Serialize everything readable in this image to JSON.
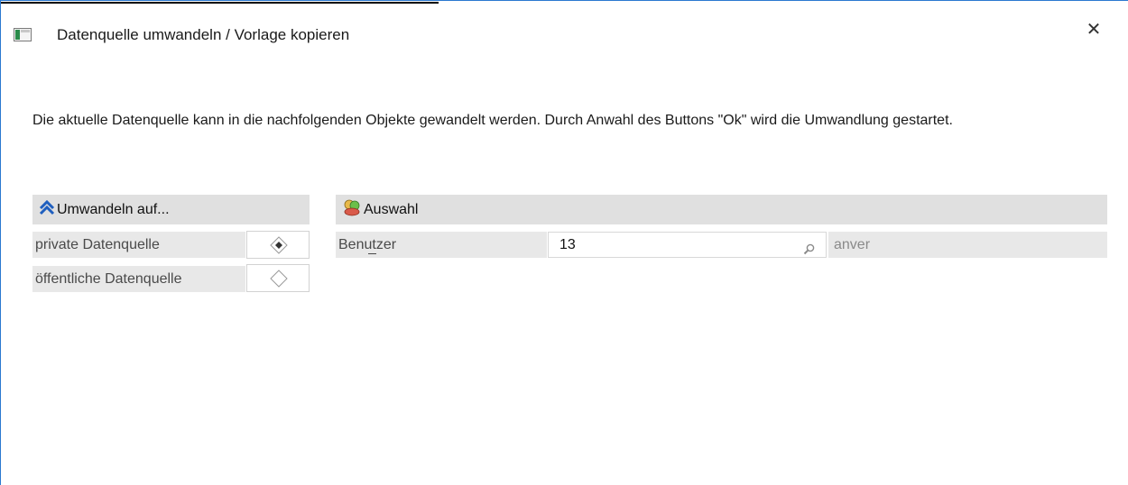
{
  "window": {
    "title": "Datenquelle umwandeln / Vorlage kopieren",
    "close_symbol": "✕"
  },
  "info_text": "Die aktuelle Datenquelle kann in die nachfolgenden Objekte gewandelt werden. Durch Anwahl des Buttons \"Ok\" wird die Umwandlung gestartet.",
  "convert_section": {
    "header": "Umwandeln auf...",
    "header_icon": "double-chevron-up-icon",
    "options": [
      {
        "label": "private Datenquelle",
        "selected": true
      },
      {
        "label": "öffentliche Datenquelle",
        "selected": false
      }
    ]
  },
  "selection_section": {
    "header": "Auswahl",
    "header_icon": "users-icon",
    "user_label": "Benutzer",
    "user_label_mnemonic": "u",
    "user_value": "13",
    "user_name": "anver",
    "search_icon": "magnifier-icon"
  },
  "colors": {
    "accent": "#2b79d0",
    "header_bg": "#e0e0e0",
    "cell_bg": "#e8e8e8"
  }
}
